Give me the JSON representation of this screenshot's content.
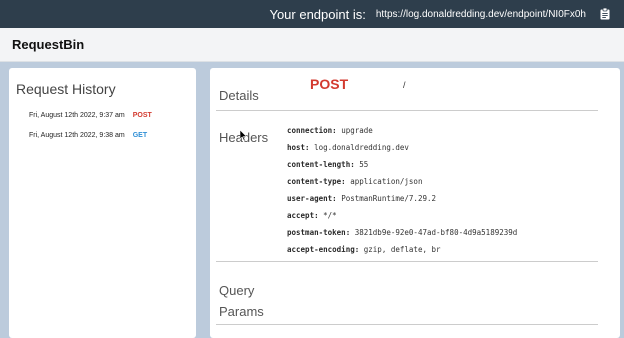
{
  "topbar": {
    "label": "Your endpoint is:",
    "url": "https://log.donaldredding.dev/endpoint/NI0Fx0h",
    "copy_icon": "clipboard-icon"
  },
  "header": {
    "brand": "RequestBin"
  },
  "history": {
    "title": "Request History",
    "requests": [
      {
        "time": "Fri, August 12th 2022, 9:37 am",
        "method": "POST"
      },
      {
        "time": "Fri, August 12th 2022, 9:38 am",
        "method": "GET"
      }
    ]
  },
  "details": {
    "title": "Details",
    "method": "POST",
    "path": "/",
    "headers_title": "Headers",
    "headers": [
      {
        "key": "connection:",
        "value": "upgrade"
      },
      {
        "key": "host:",
        "value": "log.donaldredding.dev"
      },
      {
        "key": "content-length:",
        "value": "55"
      },
      {
        "key": "content-type:",
        "value": "application/json"
      },
      {
        "key": "user-agent:",
        "value": "PostmanRuntime/7.29.2"
      },
      {
        "key": "accept:",
        "value": "*/*"
      },
      {
        "key": "postman-token:",
        "value": "3821db9e-92e0-47ad-bf80-4d9a5189239d"
      },
      {
        "key": "accept-encoding:",
        "value": "gzip, deflate, br"
      }
    ],
    "query_title_line1": "Query",
    "query_title_line2": "Params"
  },
  "colors": {
    "topbar": "#2e3e4c",
    "post": "#d33a2f",
    "get": "#2f8fd6",
    "background": "#bccbdc"
  }
}
